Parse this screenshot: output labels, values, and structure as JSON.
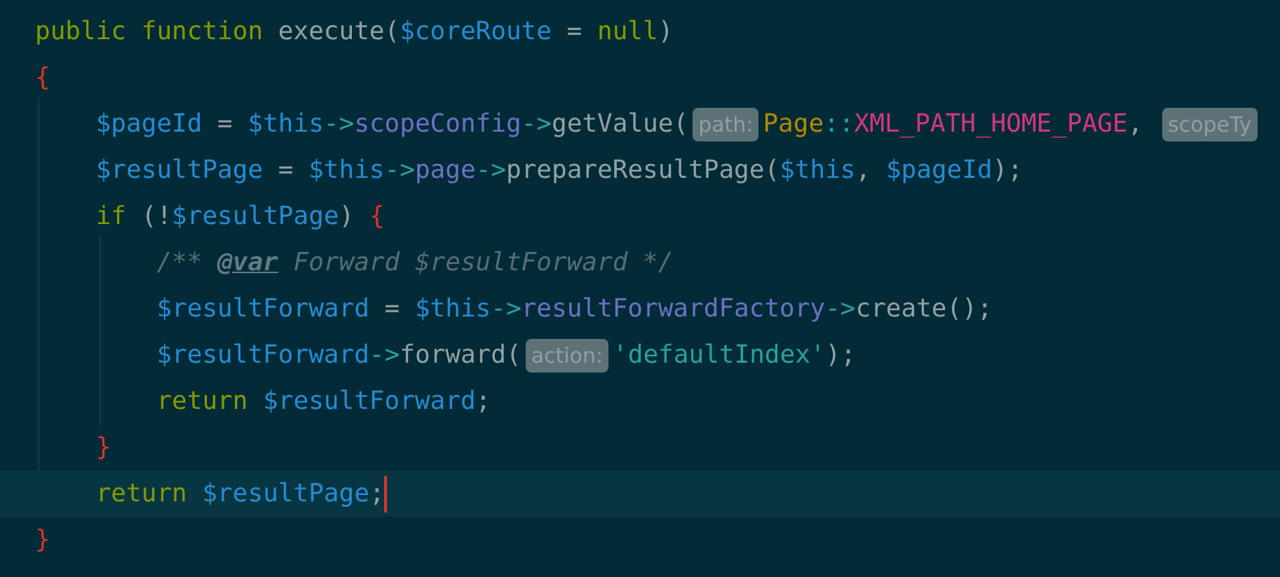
{
  "editor": {
    "lines": [
      {
        "selected": false,
        "cursor": false,
        "tokens": [
          {
            "kind": "keyword",
            "text": "public function "
          },
          {
            "kind": "plain",
            "text": "execute("
          },
          {
            "kind": "var",
            "text": "$coreRoute"
          },
          {
            "kind": "plain",
            "text": " = "
          },
          {
            "kind": "keyword",
            "text": "null"
          },
          {
            "kind": "plain",
            "text": ")"
          }
        ]
      },
      {
        "selected": false,
        "cursor": false,
        "tokens": [
          {
            "kind": "brace",
            "text": "{"
          }
        ]
      },
      {
        "selected": false,
        "cursor": false,
        "tokens": [
          {
            "kind": "var",
            "text": "    $pageId"
          },
          {
            "kind": "plain",
            "text": " = "
          },
          {
            "kind": "var",
            "text": "$this"
          },
          {
            "kind": "arrow",
            "text": "->"
          },
          {
            "kind": "prop",
            "text": "scopeConfig"
          },
          {
            "kind": "arrow",
            "text": "->"
          },
          {
            "kind": "plain",
            "text": "getValue("
          },
          {
            "kind": "hint",
            "text": "path:"
          },
          {
            "kind": "class",
            "text": "Page"
          },
          {
            "kind": "arrow",
            "text": "::"
          },
          {
            "kind": "const",
            "text": "XML_PATH_HOME_PAGE"
          },
          {
            "kind": "plain",
            "text": ", "
          },
          {
            "kind": "hint",
            "text": "scopeTy"
          }
        ]
      },
      {
        "selected": false,
        "cursor": false,
        "tokens": [
          {
            "kind": "var",
            "text": "    $resultPage"
          },
          {
            "kind": "plain",
            "text": " = "
          },
          {
            "kind": "var",
            "text": "$this"
          },
          {
            "kind": "arrow",
            "text": "->"
          },
          {
            "kind": "prop",
            "text": "page"
          },
          {
            "kind": "arrow",
            "text": "->"
          },
          {
            "kind": "plain",
            "text": "prepareResultPage("
          },
          {
            "kind": "var",
            "text": "$this"
          },
          {
            "kind": "plain",
            "text": ", "
          },
          {
            "kind": "var",
            "text": "$pageId"
          },
          {
            "kind": "plain",
            "text": ");"
          }
        ]
      },
      {
        "selected": false,
        "cursor": false,
        "tokens": [
          {
            "kind": "keyword",
            "text": "    if "
          },
          {
            "kind": "plain",
            "text": "(!"
          },
          {
            "kind": "var",
            "text": "$resultPage"
          },
          {
            "kind": "plain",
            "text": ") "
          },
          {
            "kind": "brace",
            "text": "{"
          }
        ]
      },
      {
        "selected": false,
        "cursor": false,
        "tokens": [
          {
            "kind": "comment",
            "text": "        /** "
          },
          {
            "kind": "doctag",
            "text": "@var"
          },
          {
            "kind": "comment",
            "text": " Forward $resultForward */"
          }
        ]
      },
      {
        "selected": false,
        "cursor": false,
        "tokens": [
          {
            "kind": "var",
            "text": "        $resultForward"
          },
          {
            "kind": "plain",
            "text": " = "
          },
          {
            "kind": "var",
            "text": "$this"
          },
          {
            "kind": "arrow",
            "text": "->"
          },
          {
            "kind": "prop",
            "text": "resultForwardFactory"
          },
          {
            "kind": "arrow",
            "text": "->"
          },
          {
            "kind": "plain",
            "text": "create();"
          }
        ]
      },
      {
        "selected": false,
        "cursor": false,
        "tokens": [
          {
            "kind": "var",
            "text": "        $resultForward"
          },
          {
            "kind": "arrow",
            "text": "->"
          },
          {
            "kind": "plain",
            "text": "forward("
          },
          {
            "kind": "hint",
            "text": "action:"
          },
          {
            "kind": "string",
            "text": "'defaultIndex'"
          },
          {
            "kind": "plain",
            "text": ");"
          }
        ]
      },
      {
        "selected": false,
        "cursor": false,
        "tokens": [
          {
            "kind": "keyword",
            "text": "        return "
          },
          {
            "kind": "var",
            "text": "$resultForward"
          },
          {
            "kind": "plain",
            "text": ";"
          }
        ]
      },
      {
        "selected": false,
        "cursor": false,
        "tokens": [
          {
            "kind": "brace",
            "text": "    }"
          }
        ]
      },
      {
        "selected": true,
        "cursor": true,
        "tokens": [
          {
            "kind": "keyword",
            "text": "    return "
          },
          {
            "kind": "var",
            "text": "$resultPage"
          },
          {
            "kind": "plain",
            "text": ";"
          }
        ]
      },
      {
        "selected": false,
        "cursor": false,
        "tokens": [
          {
            "kind": "brace",
            "text": "}"
          }
        ]
      }
    ]
  }
}
